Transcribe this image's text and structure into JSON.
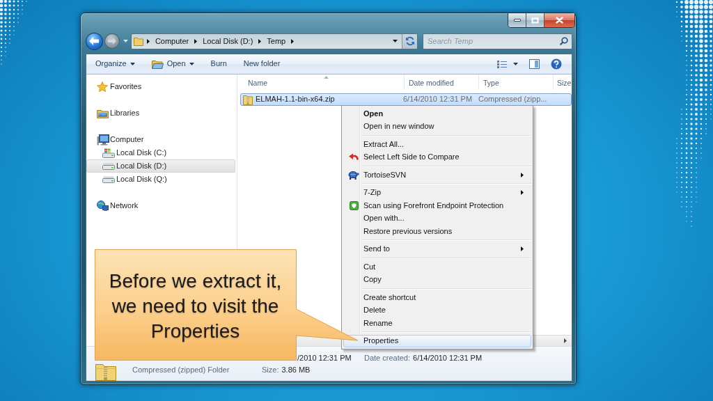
{
  "address_bar": {
    "breadcrumbs": [
      "Computer",
      "Local Disk (D:)",
      "Temp"
    ]
  },
  "search": {
    "placeholder": "Search Temp"
  },
  "toolbar": {
    "buttons": [
      {
        "label": "Organize",
        "kind": "menu"
      },
      {
        "label": "Open",
        "kind": "open"
      },
      {
        "label": "Burn",
        "kind": "plain"
      },
      {
        "label": "New folder",
        "kind": "plain"
      }
    ]
  },
  "navigation": {
    "items": [
      {
        "label": "Favorites",
        "kind": "favorites",
        "selected": false
      },
      {
        "label": "Libraries",
        "kind": "libraries",
        "selected": false
      },
      {
        "label": "Computer",
        "kind": "computer",
        "selected": false,
        "children": [
          {
            "label": "Local Disk (C:)",
            "kind": "system_drive",
            "selected": false
          },
          {
            "label": "Local Disk (D:)",
            "kind": "drive",
            "selected": true
          },
          {
            "label": "Local Disk (Q:)",
            "kind": "drive",
            "selected": false
          }
        ]
      },
      {
        "label": "Network",
        "kind": "network",
        "selected": false
      }
    ]
  },
  "file_list": {
    "columns": [
      {
        "label": "Name",
        "sorted": true
      },
      {
        "label": "Date modified",
        "sorted": false
      },
      {
        "label": "Type",
        "sorted": false
      },
      {
        "label": "Size",
        "sorted": false
      }
    ],
    "rows": [
      {
        "name": "ELMAH-1.1-bin-x64.zip",
        "date_modified": "6/14/2010 12:31 PM",
        "type": "Compressed (zipp...",
        "selected": true
      }
    ]
  },
  "context_menu": {
    "groups": [
      [
        {
          "label": "Open",
          "kind": "default",
          "submenu": false,
          "selected": false
        },
        {
          "label": "Open in new window",
          "kind": "plain",
          "submenu": false,
          "selected": false
        }
      ],
      [
        {
          "label": "Extract All...",
          "kind": "plain",
          "submenu": false,
          "selected": false
        },
        {
          "label": "Select Left Side to Compare",
          "kind": "compare",
          "submenu": false,
          "selected": false
        }
      ],
      [
        {
          "label": "TortoiseSVN",
          "kind": "svn",
          "submenu": true,
          "selected": false
        }
      ],
      [
        {
          "label": "7-Zip",
          "kind": "plain",
          "submenu": true,
          "selected": false
        },
        {
          "label": "Scan using Forefront Endpoint Protection",
          "kind": "scan",
          "submenu": false,
          "selected": false
        },
        {
          "label": "Open with...",
          "kind": "plain",
          "submenu": false,
          "selected": false
        },
        {
          "label": "Restore previous versions",
          "kind": "plain",
          "submenu": false,
          "selected": false
        }
      ],
      [
        {
          "label": "Send to",
          "kind": "plain",
          "submenu": true,
          "selected": false
        }
      ],
      [
        {
          "label": "Cut",
          "kind": "plain",
          "submenu": false,
          "selected": false
        },
        {
          "label": "Copy",
          "kind": "plain",
          "submenu": false,
          "selected": false
        }
      ],
      [
        {
          "label": "Create shortcut",
          "kind": "plain",
          "submenu": false,
          "selected": false
        },
        {
          "label": "Delete",
          "kind": "plain",
          "submenu": false,
          "selected": false
        },
        {
          "label": "Rename",
          "kind": "plain",
          "submenu": false,
          "selected": false
        }
      ],
      [
        {
          "label": "Properties",
          "kind": "plain",
          "submenu": false,
          "selected": true
        }
      ]
    ]
  },
  "details_pane": {
    "type": "Compressed (zipped) Folder",
    "date_modified": "/2010 12:31 PM",
    "size_label": "Size:",
    "size": "3.86 MB",
    "date_created_label": "Date created:",
    "date_created": "6/14/2010 12:31 PM"
  },
  "callout": {
    "text": "Before we extract it, we need to visit the Properties"
  }
}
